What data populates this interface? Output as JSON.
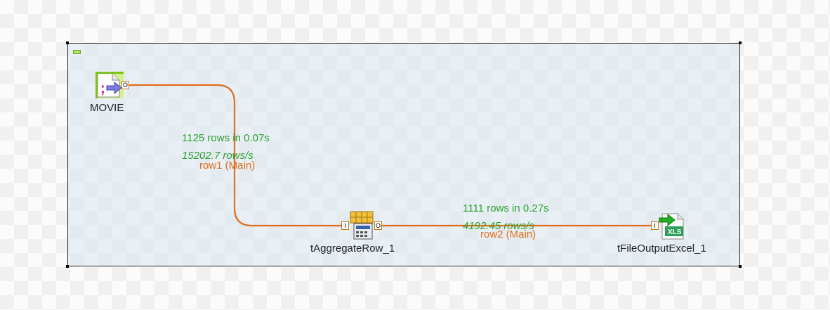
{
  "colors": {
    "link_line": "#e06d1b",
    "stat_text": "#2e9e2e",
    "link_label_text": "#e06d1b"
  },
  "components": [
    {
      "label": "MOVIE",
      "icon": "delimited-file-input-icon"
    },
    {
      "label": "tAggregateRow_1",
      "icon": "aggregate-row-icon"
    },
    {
      "label": "tFileOutputExcel_1",
      "icon": "excel-output-icon"
    }
  ],
  "links": [
    {
      "name": "row1 (Main)",
      "stats_rows": "1125 rows in 0.07s",
      "stats_rate": "15202.7 rows/s"
    },
    {
      "name": "row2 (Main)",
      "stats_rows": "1111 rows in 0.27s",
      "stats_rate": "4192.45 rows/s"
    }
  ],
  "ports": {
    "output": "O",
    "input": "I",
    "excel_badge": "XLS"
  }
}
